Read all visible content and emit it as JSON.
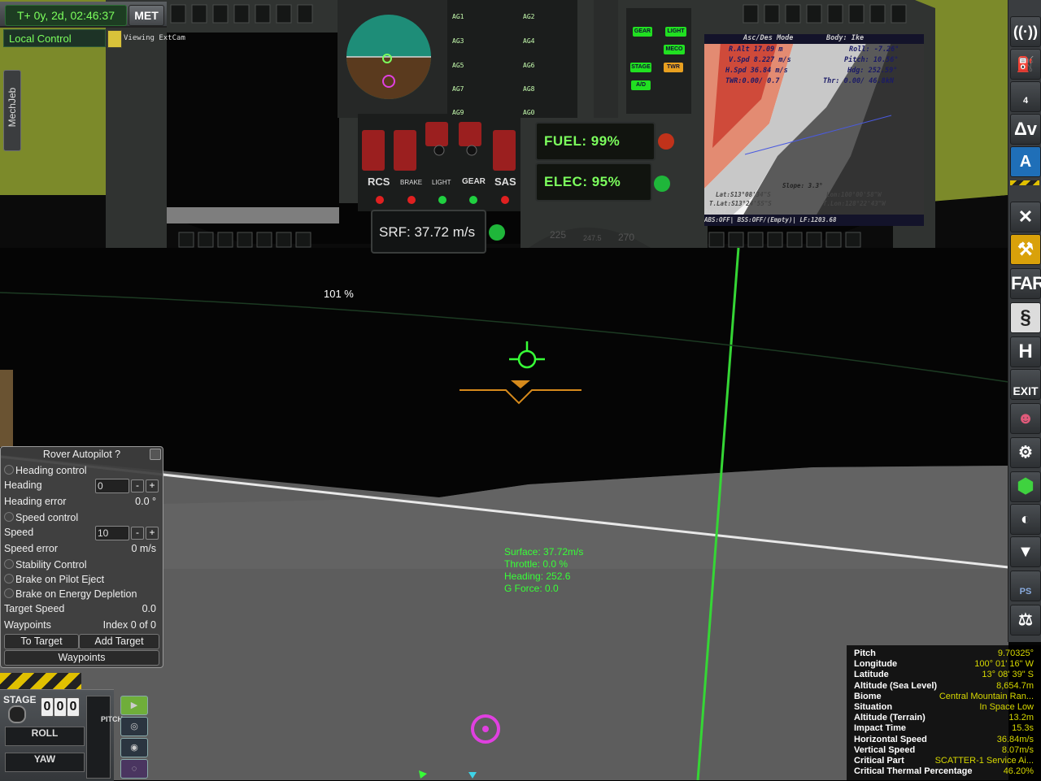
{
  "met": {
    "time": "T+ 0y, 2d, 02:46:37",
    "label": "MET"
  },
  "control": {
    "local_control": "Local Control"
  },
  "camera": {
    "text": "Viewing ExtCam"
  },
  "mechjeb": {
    "label": "MechJeb"
  },
  "dashboard": {
    "fuel": "FUEL:  99%",
    "elec": "ELEC:  95%",
    "surface_speed": "SRF: 37.72 m/s",
    "switches": {
      "rcs": "RCS",
      "brake": "BRAKE",
      "light": "LIGHT",
      "gear": "GEAR",
      "sas": "SAS"
    },
    "action_groups": [
      "AG1",
      "AG2",
      "AG3",
      "AG4",
      "AG5",
      "AG6",
      "AG7",
      "AG8",
      "AG9",
      "AG0"
    ],
    "mode_buttons": [
      "GEAR",
      "LIGHT",
      "STAGE",
      "MECO",
      "A/D",
      "TWR"
    ],
    "heading_tape": [
      "225",
      "247.5",
      "270"
    ]
  },
  "mfd": {
    "mode": "Asc/Des Mode",
    "body": "Body: Ike",
    "lines_left": [
      "R.Alt 17.09 m",
      "V.Spd 8.227 m/s",
      "H.Spd 36.84 m/s",
      "TWR:0.00/ 0.7"
    ],
    "lines_right": [
      "Roll:    -7.26°",
      "Pitch:   10.56°",
      "Hdg:    252.59°",
      "Thr:  0.00/  46.8kN"
    ],
    "bottom": [
      "Slope: 3.3°",
      "Lat:S13°08'34\"S",
      "Lon:100°00'58\"W",
      "T.Lat:S13°24'55\"S",
      "T.Lon:128°22'43\"W",
      "Ascent",
      "ABS:OFF| BSS:OFF/(Empty)| LF:1203.68"
    ]
  },
  "hud": {
    "percent": "101 %",
    "lines": [
      "Surface: 37.72m/s",
      "Throttle: 0.0 %",
      "Heading: 252.6",
      "G Force: 0.0"
    ]
  },
  "rover_autopilot": {
    "title": "Rover Autopilot  ?",
    "heading_control": "Heading control",
    "heading_label": "Heading",
    "heading_value": "0",
    "heading_error_label": "Heading error",
    "heading_error_value": "0.0 °",
    "speed_control": "Speed control",
    "speed_label": "Speed",
    "speed_value": "10",
    "speed_error_label": "Speed error",
    "speed_error_value": "0 m/s",
    "stability_control": "Stability Control",
    "brake_pilot": "Brake on Pilot Eject",
    "brake_energy": "Brake on Energy Depletion",
    "target_speed_label": "Target Speed",
    "target_speed_value": "0.0",
    "waypoints_label": "Waypoints",
    "waypoints_value": "Index 0 of 0",
    "to_target": "To Target",
    "add_target": "Add Target",
    "waypoints_button": "Waypoints",
    "minus": "-",
    "plus": "+"
  },
  "staging": {
    "stage_label": "STAGE",
    "stage_digits": [
      "0",
      "0",
      "0"
    ],
    "roll": "ROLL",
    "yaw": "YAW",
    "pitch": "PITCH"
  },
  "toolbar": {
    "dv": "Δv",
    "farc": "FARc",
    "exit": "EXIT",
    "ps": "PS",
    "count": "4"
  },
  "info_panel": {
    "rows": [
      {
        "k": "Pitch",
        "v": "9.70325°"
      },
      {
        "k": "Longitude",
        "v": "100° 01' 16\" W"
      },
      {
        "k": "Latitude",
        "v": "13° 08' 39\" S"
      },
      {
        "k": "Altitude (Sea Level)",
        "v": "8,654.7m"
      },
      {
        "k": "Biome",
        "v": "Central Mountain Ran..."
      },
      {
        "k": "Situation",
        "v": "In Space Low"
      },
      {
        "k": "Altitude (Terrain)",
        "v": "13.2m"
      },
      {
        "k": "Impact Time",
        "v": "15.3s"
      },
      {
        "k": "Horizontal Speed",
        "v": "36.84m/s"
      },
      {
        "k": "Vertical Speed",
        "v": "8.07m/s"
      },
      {
        "k": "Critical Part",
        "v": "SCATTER-1 Service Ai..."
      },
      {
        "k": "Critical Thermal Percentage",
        "v": "46.20%"
      }
    ]
  },
  "colors": {
    "hud_green": "#37ff37",
    "info_value": "#d7d800",
    "gauge_green": "#7cff5d",
    "target_magenta": "#e040e0",
    "marker_orange": "#d68a1c"
  }
}
